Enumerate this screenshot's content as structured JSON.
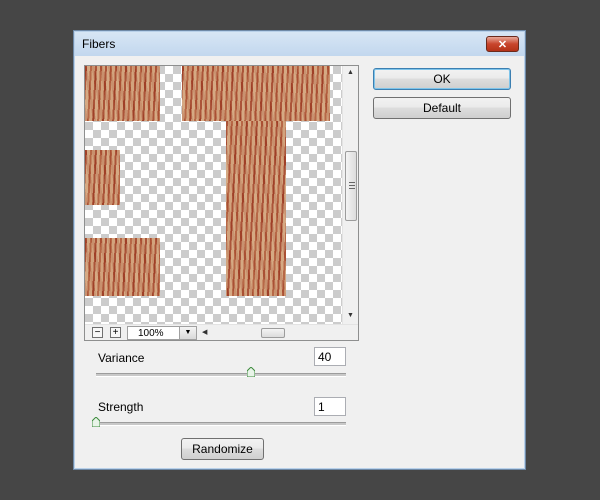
{
  "window": {
    "title": "Fibers",
    "close_glyph": "✕"
  },
  "buttons": {
    "ok": "OK",
    "default": "Default",
    "randomize": "Randomize"
  },
  "preview": {
    "zoom_out": "−",
    "zoom_in": "+",
    "zoom_level": "100%",
    "zoom_drop": "▼",
    "left_arrow": "◀",
    "up_arrow": "▲",
    "down_arrow": "▼"
  },
  "variance": {
    "label": "Variance",
    "value": "40",
    "level": 0.62
  },
  "strength": {
    "label": "Strength",
    "value": "1",
    "level": 0.0
  },
  "colors": {
    "fiber_dark": "#9a2f19",
    "fiber_light": "#d9b38c",
    "slider_handle": "#4a9a4a"
  }
}
